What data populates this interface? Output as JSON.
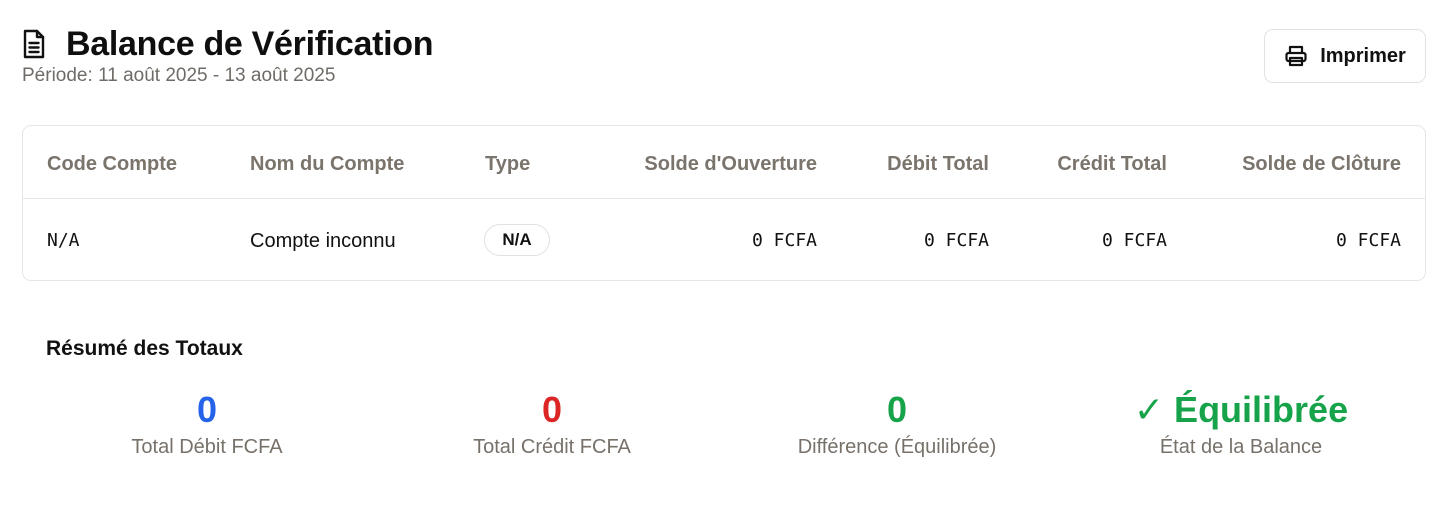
{
  "header": {
    "title": "Balance de Vérification",
    "period_label": "Période:",
    "period_value": "11 août 2025 - 13 août 2025",
    "icon": "document-icon"
  },
  "actions": {
    "print_label": "Imprimer",
    "print_icon": "printer-icon"
  },
  "table": {
    "columns": [
      "Code Compte",
      "Nom du Compte",
      "Type",
      "Solde d'Ouverture",
      "Débit Total",
      "Crédit Total",
      "Solde de Clôture"
    ],
    "rows": [
      {
        "code": "N/A",
        "name": "Compte inconnu",
        "type": "N/A",
        "opening": "0 FCFA",
        "debit": "0 FCFA",
        "credit": "0 FCFA",
        "closing": "0 FCFA"
      }
    ]
  },
  "summary": {
    "title": "Résumé des Totaux",
    "items": [
      {
        "value": "0",
        "label": "Total Débit FCFA",
        "color": "#2563eb"
      },
      {
        "value": "0",
        "label": "Total Crédit FCFA",
        "color": "#dc2626"
      },
      {
        "value": "0",
        "label": "Différence (Équilibrée)",
        "color": "#16a34a"
      },
      {
        "value": "✓ Équilibrée",
        "label": "État de la Balance",
        "color": "#16a34a"
      }
    ]
  }
}
